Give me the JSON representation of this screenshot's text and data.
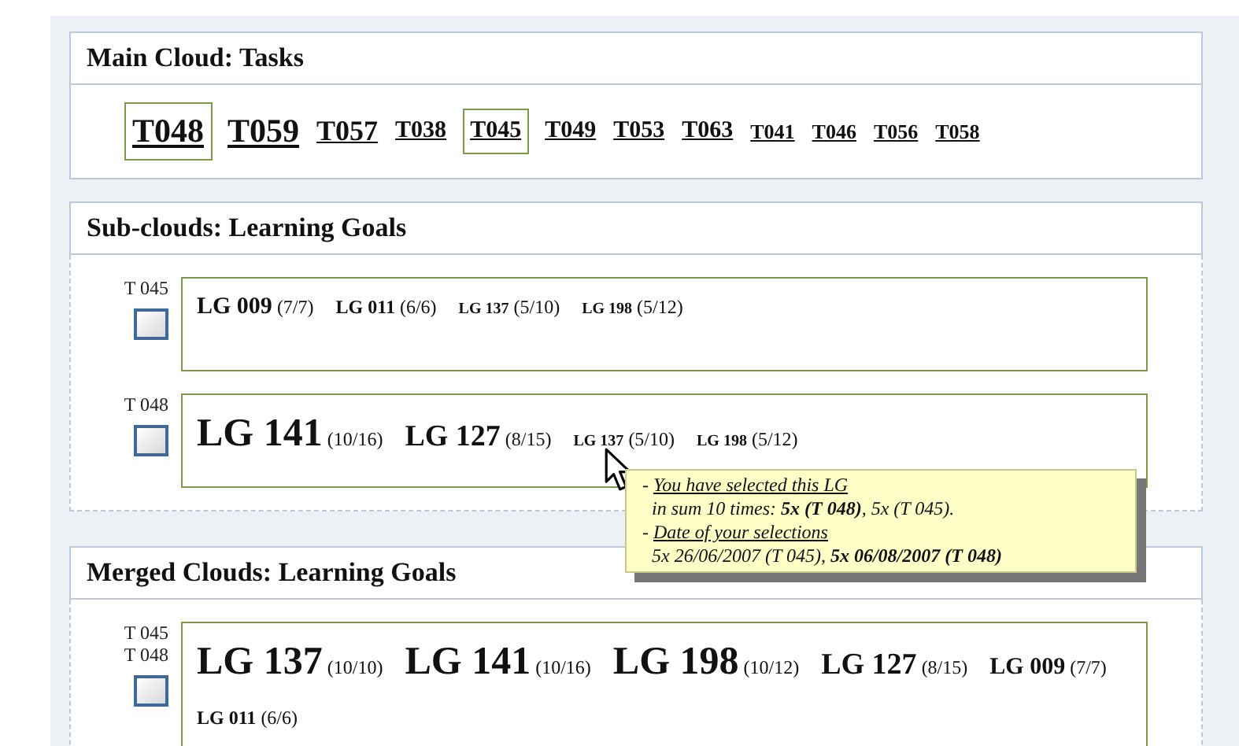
{
  "main_cloud": {
    "title": "Main Cloud: Tasks",
    "tasks": [
      {
        "label": "T048",
        "kind": "huge",
        "selected": true
      },
      {
        "label": "T059",
        "kind": "huge",
        "selected": false
      },
      {
        "label": "T057",
        "kind": "large",
        "selected": false
      },
      {
        "label": "T038",
        "kind": "medium",
        "selected": false
      },
      {
        "label": "T045",
        "kind": "medium",
        "selected": true
      },
      {
        "label": "T049",
        "kind": "medium",
        "selected": false
      },
      {
        "label": "T053",
        "kind": "medium",
        "selected": false
      },
      {
        "label": "T063",
        "kind": "medium",
        "selected": false
      },
      {
        "label": "T041",
        "kind": "small",
        "selected": false
      },
      {
        "label": "T046",
        "kind": "small",
        "selected": false
      },
      {
        "label": "T056",
        "kind": "small",
        "selected": false
      },
      {
        "label": "T058",
        "kind": "small",
        "selected": false
      }
    ]
  },
  "sub_clouds": {
    "title": "Sub-clouds: Learning Goals",
    "rows": [
      {
        "tasks": [
          "T 045"
        ],
        "checked": false,
        "goals": [
          {
            "code": "LG 009",
            "count": "(7/7)",
            "kind": "medium"
          },
          {
            "code": "LG 011",
            "count": "(6/6)",
            "kind": "small"
          },
          {
            "code": "LG 137",
            "count": "(5/10)",
            "kind": "tiny"
          },
          {
            "code": "LG 198",
            "count": "(5/12)",
            "kind": "tiny"
          }
        ]
      },
      {
        "tasks": [
          "T 048"
        ],
        "checked": false,
        "goals": [
          {
            "code": "LG 141",
            "count": "(10/16)",
            "kind": "huge"
          },
          {
            "code": "LG 127",
            "count": "(8/15)",
            "kind": "large"
          },
          {
            "code": "LG 137",
            "count": "(5/10)",
            "kind": "tiny"
          },
          {
            "code": "LG 198",
            "count": "(5/12)",
            "kind": "tiny"
          }
        ]
      }
    ]
  },
  "tooltip": {
    "lines": [
      {
        "kind": "heading",
        "marker": "-",
        "text": "You have selected this LG"
      },
      {
        "kind": "detail",
        "text": "in sum 10 times: **5x  (T 048)**, 5x (T 045)."
      },
      {
        "kind": "heading",
        "marker": "-",
        "text": "Date of your selections"
      },
      {
        "kind": "detail",
        "text": "5x 26/06/2007 (T 045), **5x 06/08/2007 (T 048)**"
      }
    ]
  },
  "merged_clouds": {
    "title": "Merged Clouds: Learning Goals",
    "rows": [
      {
        "tasks": [
          "T 045",
          "T 048"
        ],
        "checked": false,
        "goals": [
          {
            "code": "LG 137",
            "count": "(10/10)",
            "kind": "huge"
          },
          {
            "code": "LG 141",
            "count": "(10/16)",
            "kind": "huge"
          },
          {
            "code": "LG 198",
            "count": "(10/12)",
            "kind": "huge"
          },
          {
            "code": "LG 127",
            "count": "(8/15)",
            "kind": "large"
          },
          {
            "code": "LG 009",
            "count": "(7/7)",
            "kind": "medium"
          },
          {
            "code": "LG 011",
            "count": "(6/6)",
            "kind": "small"
          }
        ]
      }
    ]
  }
}
